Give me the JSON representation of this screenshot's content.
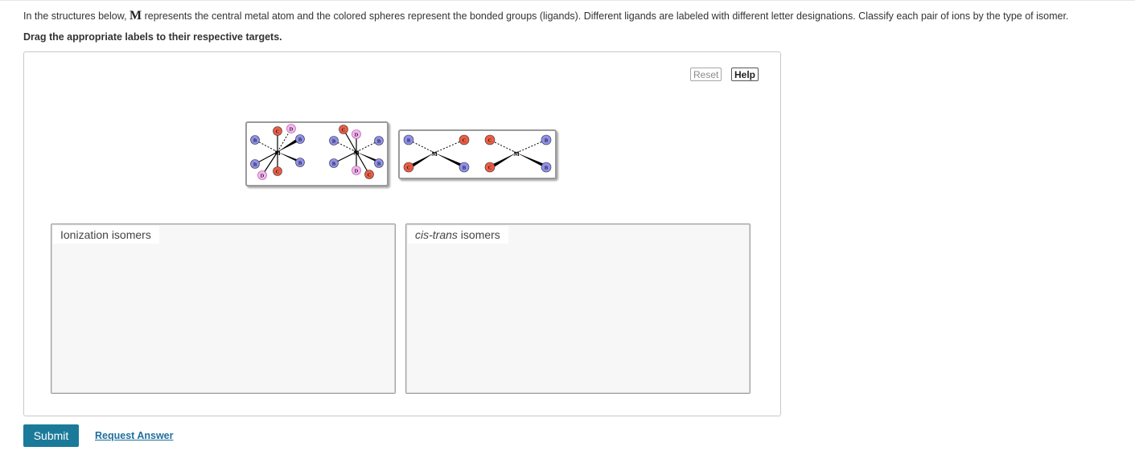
{
  "instructions": {
    "part1": "In the structures below, ",
    "metal_symbol": "M",
    "part2": " represents the central metal atom and the colored spheres represent the bonded groups (ligands). Different ligands are labeled with different letter designations. Classify each pair of ions by the type of isomer.",
    "drag_hint": "Drag the appropriate labels to their respective targets."
  },
  "toolbar": {
    "reset_label": "Reset",
    "help_label": "Help"
  },
  "tiles": {
    "tile1": {
      "metal": "M",
      "left_structure": [
        "C",
        "D",
        "B",
        "B",
        "B",
        "B",
        "C",
        "D"
      ],
      "right_structure": [
        "C",
        "D",
        "B",
        "B",
        "B",
        "B",
        "D",
        "C"
      ]
    },
    "tile2": {
      "metal": "M",
      "left_structure": [
        "B",
        "C",
        "C",
        "B"
      ],
      "right_structure": [
        "C",
        "B",
        "C",
        "B"
      ]
    }
  },
  "ligand_colors": {
    "B": "#8f8ff0",
    "C": "#ee5c44",
    "D": "#f4b6ee"
  },
  "targets": {
    "ionization": {
      "label": "Ionization isomers"
    },
    "cistrans": {
      "label_italic": "cis-trans",
      "label_rest": " isomers"
    }
  },
  "actions": {
    "submit_label": "Submit",
    "request_answer_label": "Request Answer"
  },
  "colors": {
    "submit_bg": "#1b7a99",
    "link": "#1f6f9c"
  }
}
